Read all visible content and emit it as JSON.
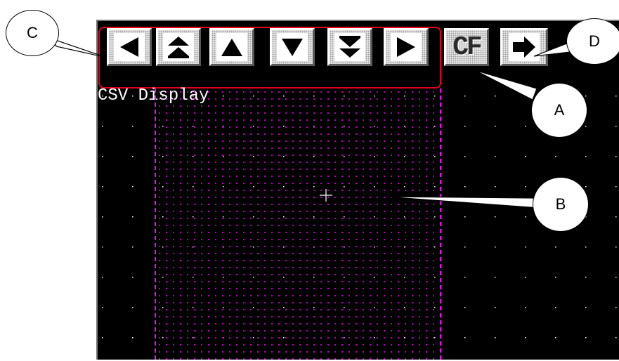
{
  "screen": {
    "title": "CSV Display",
    "background": "#000000",
    "grid_dot_color": "#ffffff",
    "area_outline_color": "#ff00ff",
    "area_dot_color": "#c200c2"
  },
  "toolbar": {
    "group_outline_color": "#e0001c",
    "buttons": [
      {
        "id": "left",
        "icon": "arrow-left-icon"
      },
      {
        "id": "page-up",
        "icon": "double-arrow-up-icon"
      },
      {
        "id": "up",
        "icon": "arrow-up-icon"
      },
      {
        "id": "down",
        "icon": "arrow-down-icon"
      },
      {
        "id": "page-down",
        "icon": "double-arrow-down-icon"
      },
      {
        "id": "right",
        "icon": "arrow-right-icon"
      },
      {
        "id": "csv",
        "label": "CF"
      },
      {
        "id": "next",
        "icon": "fat-arrow-right-icon"
      }
    ]
  },
  "callouts": {
    "a": "A",
    "b": "B",
    "c": "C",
    "d": "D"
  }
}
